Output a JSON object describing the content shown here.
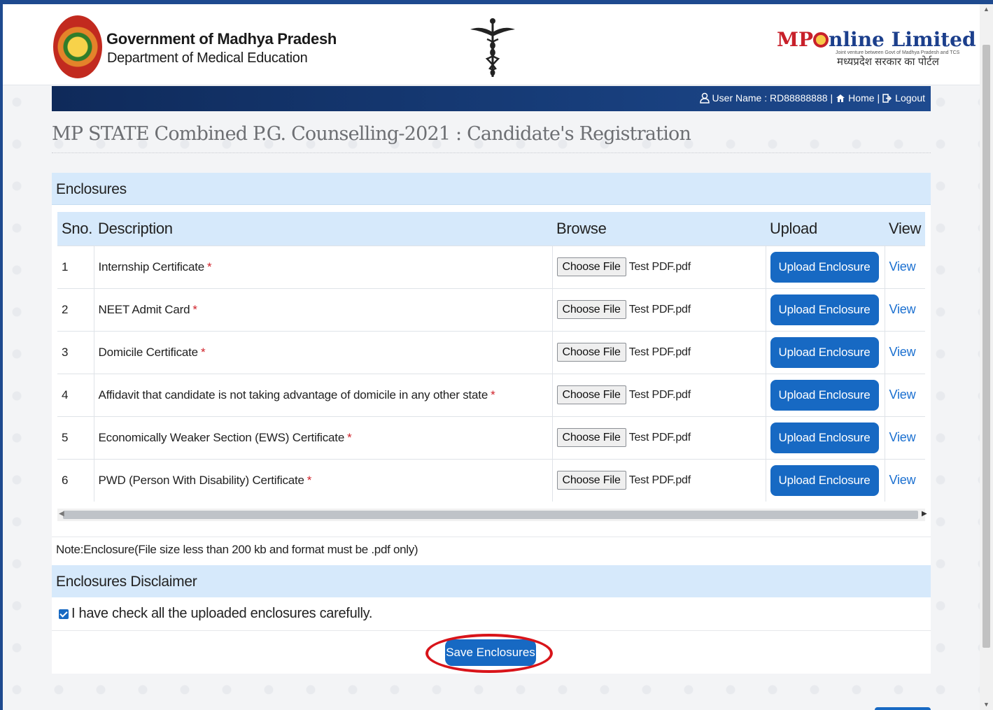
{
  "header": {
    "gov_title": "Government of Madhya Pradesh",
    "gov_sub": "Department of Medical Education",
    "mp_logo_mp": "MP",
    "mp_logo_rest": "nline Limited",
    "mp_tagline": "Joint venture between Govt of Madhya Pradesh and TCS",
    "mp_hindi": "मध्यप्रदेश सरकार का पोर्टल"
  },
  "navbar": {
    "user_label": "User Name : RD88888888",
    "separator": "|",
    "home_label": "Home",
    "logout_label": "Logout"
  },
  "page_title": "MP STATE Combined P.G. Counselling-2021 : Candidate's Registration",
  "enclosures": {
    "heading": "Enclosures",
    "columns": [
      "Sno.",
      "Description",
      "Browse",
      "Upload",
      "View"
    ],
    "required_mark": "*",
    "choose_label": "Choose File",
    "upload_label": "Upload Enclosure",
    "view_label": "View",
    "rows": [
      {
        "sno": "1",
        "description": "Internship Certificate",
        "file": "Test PDF.pdf"
      },
      {
        "sno": "2",
        "description": "NEET Admit Card",
        "file": "Test PDF.pdf"
      },
      {
        "sno": "3",
        "description": "Domicile Certificate",
        "file": "Test PDF.pdf"
      },
      {
        "sno": "4",
        "description": "Affidavit that candidate is not taking advantage of domicile in any other state",
        "file": "Test PDF.pdf"
      },
      {
        "sno": "5",
        "description": "Economically Weaker Section (EWS) Certificate",
        "file": "Test PDF.pdf"
      },
      {
        "sno": "6",
        "description": "PWD (Person With Disability) Certificate",
        "file": "Test PDF.pdf"
      }
    ]
  },
  "note": "Note:Enclosure(File size less than 200 kb and format must be .pdf only)",
  "disclaimer": {
    "heading": "Enclosures Disclaimer",
    "checkbox_label": "I have check all the uploaded enclosures carefully.",
    "checked": true
  },
  "save_label": "Save Enclosures",
  "colors": {
    "primary_button": "#1769c3",
    "panel_header": "#d6e9fb",
    "highlight": "#d8141a",
    "navbar": "#173d7a"
  },
  "icons": [
    "user-icon",
    "home-icon",
    "logout-icon",
    "caduceus-icon",
    "state-seal-icon"
  ]
}
